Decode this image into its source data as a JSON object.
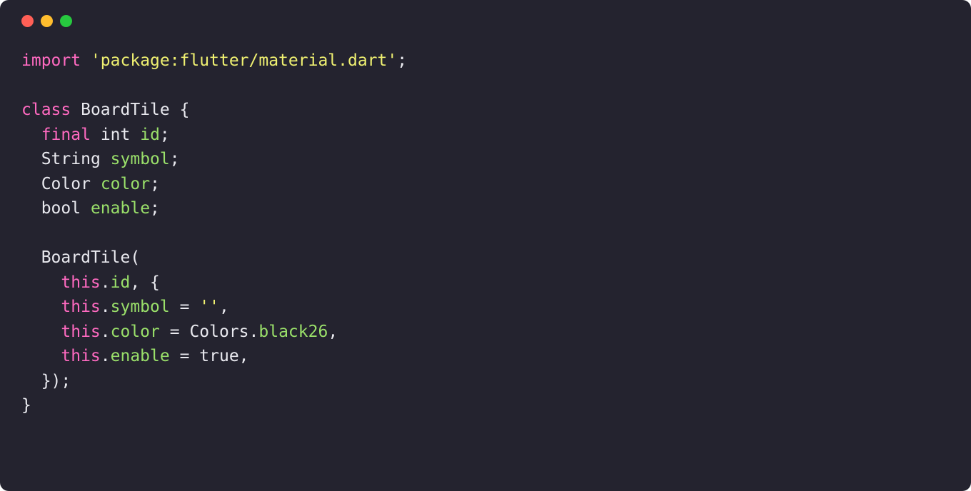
{
  "titlebar": {
    "buttons": [
      "close",
      "minimize",
      "zoom"
    ]
  },
  "code": {
    "tokens": [
      [
        [
          "key",
          "import"
        ],
        [
          "punc",
          " "
        ],
        [
          "str",
          "'package:flutter/material.dart'"
        ],
        [
          "punc",
          ";"
        ]
      ],
      [
        [
          "punc",
          ""
        ]
      ],
      [
        [
          "key",
          "class"
        ],
        [
          "punc",
          " "
        ],
        [
          "type",
          "BoardTile"
        ],
        [
          "punc",
          " {"
        ]
      ],
      [
        [
          "punc",
          "  "
        ],
        [
          "key",
          "final"
        ],
        [
          "punc",
          " "
        ],
        [
          "type",
          "int"
        ],
        [
          "punc",
          " "
        ],
        [
          "name",
          "id"
        ],
        [
          "punc",
          ";"
        ]
      ],
      [
        [
          "punc",
          "  "
        ],
        [
          "type",
          "String"
        ],
        [
          "punc",
          " "
        ],
        [
          "name",
          "symbol"
        ],
        [
          "punc",
          ";"
        ]
      ],
      [
        [
          "punc",
          "  "
        ],
        [
          "type",
          "Color"
        ],
        [
          "punc",
          " "
        ],
        [
          "name",
          "color"
        ],
        [
          "punc",
          ";"
        ]
      ],
      [
        [
          "punc",
          "  "
        ],
        [
          "type",
          "bool"
        ],
        [
          "punc",
          " "
        ],
        [
          "name",
          "enable"
        ],
        [
          "punc",
          ";"
        ]
      ],
      [
        [
          "punc",
          ""
        ]
      ],
      [
        [
          "punc",
          "  "
        ],
        [
          "type",
          "BoardTile"
        ],
        [
          "punc",
          "("
        ]
      ],
      [
        [
          "punc",
          "    "
        ],
        [
          "key",
          "this"
        ],
        [
          "punc",
          "."
        ],
        [
          "name",
          "id"
        ],
        [
          "punc",
          ", {"
        ]
      ],
      [
        [
          "punc",
          "    "
        ],
        [
          "key",
          "this"
        ],
        [
          "punc",
          "."
        ],
        [
          "name",
          "symbol"
        ],
        [
          "punc",
          " = "
        ],
        [
          "str",
          "''"
        ],
        [
          "punc",
          ","
        ]
      ],
      [
        [
          "punc",
          "    "
        ],
        [
          "key",
          "this"
        ],
        [
          "punc",
          "."
        ],
        [
          "name",
          "color"
        ],
        [
          "punc",
          " = "
        ],
        [
          "type",
          "Colors"
        ],
        [
          "punc",
          "."
        ],
        [
          "name",
          "black26"
        ],
        [
          "punc",
          ","
        ]
      ],
      [
        [
          "punc",
          "    "
        ],
        [
          "key",
          "this"
        ],
        [
          "punc",
          "."
        ],
        [
          "name",
          "enable"
        ],
        [
          "punc",
          " = "
        ],
        [
          "type",
          "true"
        ],
        [
          "punc",
          ","
        ]
      ],
      [
        [
          "punc",
          "  });"
        ]
      ],
      [
        [
          "punc",
          "}"
        ]
      ]
    ]
  }
}
